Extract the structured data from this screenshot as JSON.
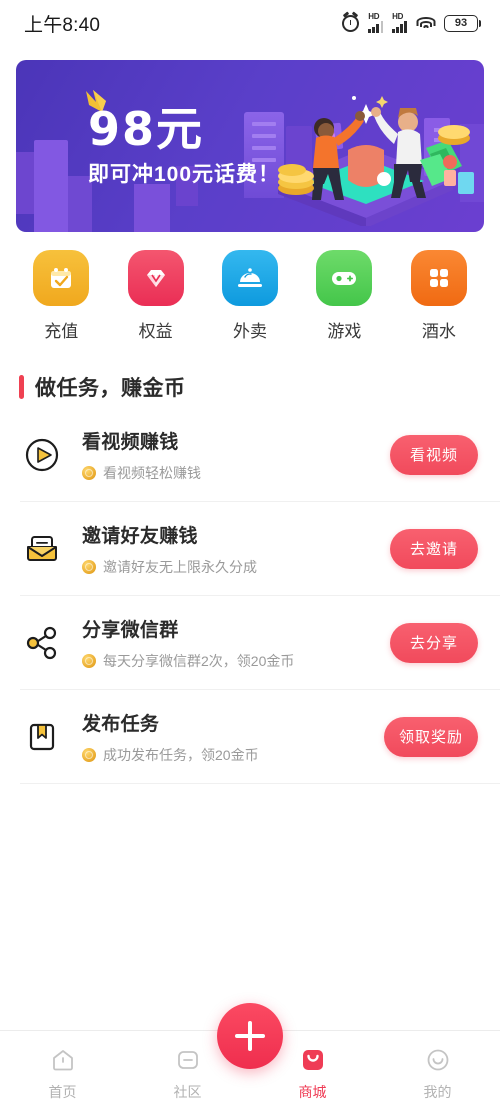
{
  "status_bar": {
    "time": "上午8:40",
    "alarm_icon": "alarm-clock-icon",
    "signal1_label": "HD",
    "signal2_label": "HD",
    "wifi_icon": "wifi-icon",
    "battery_level": "93"
  },
  "banner": {
    "headline": "98元",
    "subline": "即可冲100元话费！",
    "crown_icon": "crown-icon",
    "bg_color": "#5a3fc9",
    "accent_color": "#f2c035"
  },
  "categories": [
    {
      "label": "充值",
      "icon": "recharge-calendar-icon",
      "color": "#f5b428"
    },
    {
      "label": "权益",
      "icon": "diamond-icon",
      "color": "#ef4060"
    },
    {
      "label": "外卖",
      "icon": "food-cloche-icon",
      "color": "#1aa8e8"
    },
    {
      "label": "游戏",
      "icon": "gamepad-icon",
      "color": "#58cc5a"
    },
    {
      "label": "酒水",
      "icon": "grid-four-icon",
      "color": "#f5761a"
    }
  ],
  "section": {
    "title": "做任务，赚金币",
    "bar_color": "#ef4152"
  },
  "tasks": [
    {
      "title": "看视频赚钱",
      "subtitle": "看视频轻松赚钱",
      "button": "看视频",
      "icon": "play-circle-icon"
    },
    {
      "title": "邀请好友赚钱",
      "subtitle": "邀请好友无上限永久分成",
      "button": "去邀请",
      "icon": "envelope-icon"
    },
    {
      "title": "分享微信群",
      "subtitle": "每天分享微信群2次，领20金币",
      "button": "去分享",
      "icon": "share-nodes-icon"
    },
    {
      "title": "发布任务",
      "subtitle": "成功发布任务，领20金币",
      "button": "领取奖励",
      "icon": "bookmark-book-icon"
    }
  ],
  "tabbar": {
    "accent_color": "#ef3c55",
    "items": [
      {
        "label": "首页",
        "icon": "home-icon",
        "active": false
      },
      {
        "label": "社区",
        "icon": "community-icon",
        "active": false
      },
      {
        "label": "商城",
        "icon": "shop-bag-icon",
        "active": true
      },
      {
        "label": "我的",
        "icon": "profile-smile-icon",
        "active": false
      }
    ],
    "fab": {
      "icon": "plus-icon",
      "label": ""
    }
  }
}
